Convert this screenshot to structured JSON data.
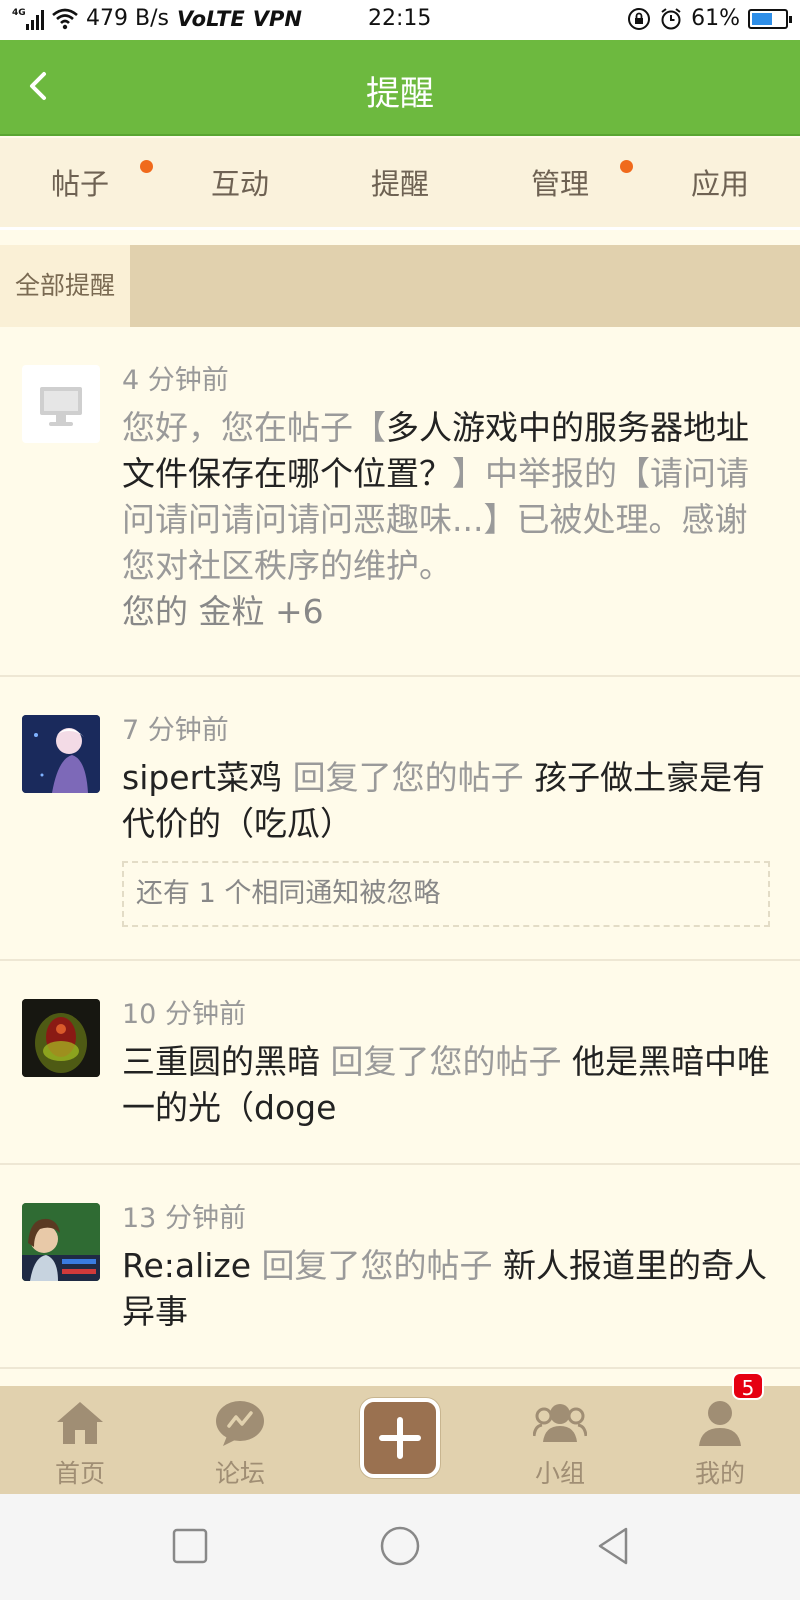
{
  "status_bar": {
    "network": "4G",
    "speed": "479 B/s",
    "volte": "VoLTE",
    "vpn": "VPN",
    "time": "22:15",
    "battery": "61%",
    "battery_level": 0.61
  },
  "header": {
    "title": "提醒"
  },
  "tabs": [
    {
      "label": "帖子",
      "dot": true
    },
    {
      "label": "互动",
      "dot": false
    },
    {
      "label": "提醒",
      "dot": false
    },
    {
      "label": "管理",
      "dot": true
    },
    {
      "label": "应用",
      "dot": false
    }
  ],
  "filter": {
    "label": "全部提醒"
  },
  "notifications": [
    {
      "time": "4 分钟前",
      "line_a": "您好，您在帖子【",
      "line_b": "多人游戏中的服务器地址文件保存在哪个位置？",
      "line_c": "】中举报的【请问请问请问请问请问恶趣味...】已被处理。感谢您对社区秩序的维护。",
      "extra": "您的 金粒 +6"
    },
    {
      "time": "7 分钟前",
      "user": "sipert菜鸡",
      "action": " 回复了您的帖子 ",
      "post": "孩子做土豪是有代价的（吃瓜）",
      "note": "还有 1 个相同通知被忽略"
    },
    {
      "time": "10 分钟前",
      "user": "三重圆的黑暗",
      "action": " 回复了您的帖子 ",
      "post": "他是黑暗中唯一的光（doge"
    },
    {
      "time": "13 分钟前",
      "user": "Re:alize",
      "action": " 回复了您的帖子 ",
      "post": "新人报道里的奇人异事"
    }
  ],
  "bottom_nav": {
    "home": "首页",
    "forum": "论坛",
    "group": "小组",
    "mine": "我的",
    "mine_badge": "5"
  },
  "colors": {
    "header_green": "#6db93f",
    "tab_bg": "#faf2dc",
    "dot_orange": "#f06a1c",
    "bottom_bg": "#e1d1ae",
    "add_button": "#9a7150",
    "badge_red": "#e60012"
  }
}
